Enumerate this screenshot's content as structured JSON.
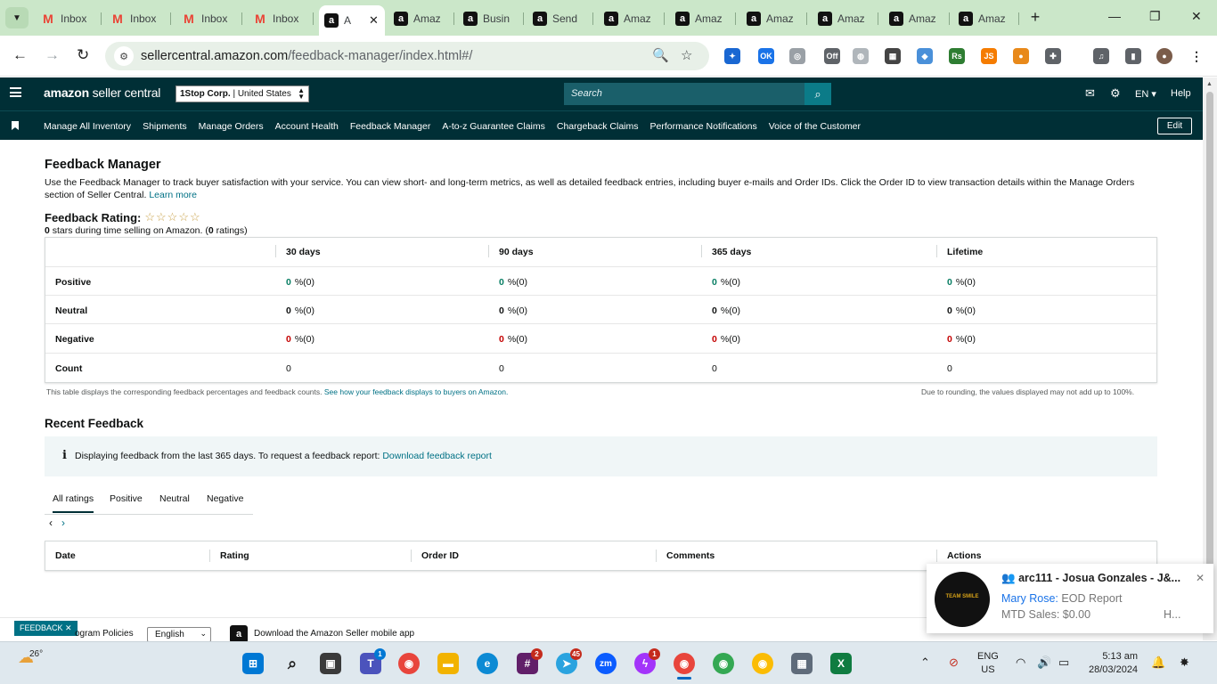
{
  "browser": {
    "tabs": [
      {
        "label": "Inbox",
        "icon": "gmail"
      },
      {
        "label": "Inbox",
        "icon": "gmail"
      },
      {
        "label": "Inbox",
        "icon": "gmail"
      },
      {
        "label": "Inbox",
        "icon": "gmail"
      },
      {
        "label": "A",
        "icon": "amazon",
        "active": true
      },
      {
        "label": "Amaz",
        "icon": "amazon"
      },
      {
        "label": "Busin",
        "icon": "amazon"
      },
      {
        "label": "Send",
        "icon": "amazon"
      },
      {
        "label": "Amaz",
        "icon": "amazon"
      },
      {
        "label": "Amaz",
        "icon": "amazon"
      },
      {
        "label": "Amaz",
        "icon": "amazon"
      },
      {
        "label": "Amaz",
        "icon": "amazon"
      },
      {
        "label": "Amaz",
        "icon": "amazon"
      },
      {
        "label": "Amaz",
        "icon": "amazon"
      }
    ],
    "url_host": "sellercentral.amazon.com",
    "url_path": "/feedback-manager/index.html#/"
  },
  "header": {
    "logo_bold": "amazon",
    "logo_rest": " seller central",
    "account_name": "1Stop Corp.",
    "account_region": " | United States",
    "search_placeholder": "Search",
    "language": "EN",
    "help": "Help"
  },
  "nav": {
    "items": [
      "Manage All Inventory",
      "Shipments",
      "Manage Orders",
      "Account Health",
      "Feedback Manager",
      "A-to-z Guarantee Claims",
      "Chargeback Claims",
      "Performance Notifications",
      "Voice of the Customer"
    ],
    "edit": "Edit"
  },
  "page": {
    "title": "Feedback Manager",
    "description": "Use the Feedback Manager to track buyer satisfaction with your service. You can view short- and long-term metrics, as well as detailed feedback entries, including buyer e-mails and Order IDs. Click the Order ID to view transaction details within the Manage Orders section of Seller Central.",
    "learn_more": "Learn more",
    "rating_label": "Feedback Rating:",
    "stars": "☆☆☆☆☆",
    "rating_sub_bold": "0",
    "rating_sub_text": " stars during time selling on Amazon. (",
    "rating_count": "0",
    "rating_sub_end": " ratings)"
  },
  "feedback_table": {
    "columns": [
      "30 days",
      "90 days",
      "365 days",
      "Lifetime"
    ],
    "rows": [
      {
        "label": "Positive",
        "values": [
          "0",
          "0",
          "0",
          "0"
        ],
        "suffix": "%(0)",
        "color": "#067d62"
      },
      {
        "label": "Neutral",
        "values": [
          "0",
          "0",
          "0",
          "0"
        ],
        "suffix": "%(0)",
        "color": "#0f1111"
      },
      {
        "label": "Negative",
        "values": [
          "0",
          "0",
          "0",
          "0"
        ],
        "suffix": "%(0)",
        "color": "#c40000"
      },
      {
        "label": "Count",
        "values": [
          "0",
          "0",
          "0",
          "0"
        ],
        "suffix": "",
        "color": "#0f1111"
      }
    ],
    "footnote_left": "This table displays the corresponding feedback percentages and feedback counts.",
    "footnote_link": "See how your feedback displays to buyers on Amazon.",
    "footnote_right": "Due to rounding, the values displayed may not add up to 100%."
  },
  "recent": {
    "title": "Recent Feedback",
    "info_text": "Displaying feedback from the last 365 days. To request a feedback report:",
    "info_link": "Download feedback report",
    "tabs": [
      "All ratings",
      "Positive",
      "Neutral",
      "Negative"
    ],
    "columns": [
      "Date",
      "Rating",
      "Order ID",
      "Comments",
      "Actions"
    ]
  },
  "footer": {
    "feedback_badge": "FEEDBACK",
    "policies": "ogram Policies",
    "language": "English",
    "app_text": "Download the Amazon Seller mobile app"
  },
  "toast": {
    "avatar_text": "TEAM SMILE",
    "title": "arc111 - Josua Gonzales - J&...",
    "sender": "Mary Rose:",
    "message": " EOD Report",
    "line2": "MTD Sales: $0.00",
    "line2_right": "H..."
  },
  "taskbar": {
    "temperature": "26°",
    "lang1": "ENG",
    "lang2": "US",
    "time": "5:13 am",
    "date": "28/03/2024",
    "badges": {
      "teams": "1",
      "slack": "2",
      "telegram": "45",
      "messenger": "1"
    }
  }
}
